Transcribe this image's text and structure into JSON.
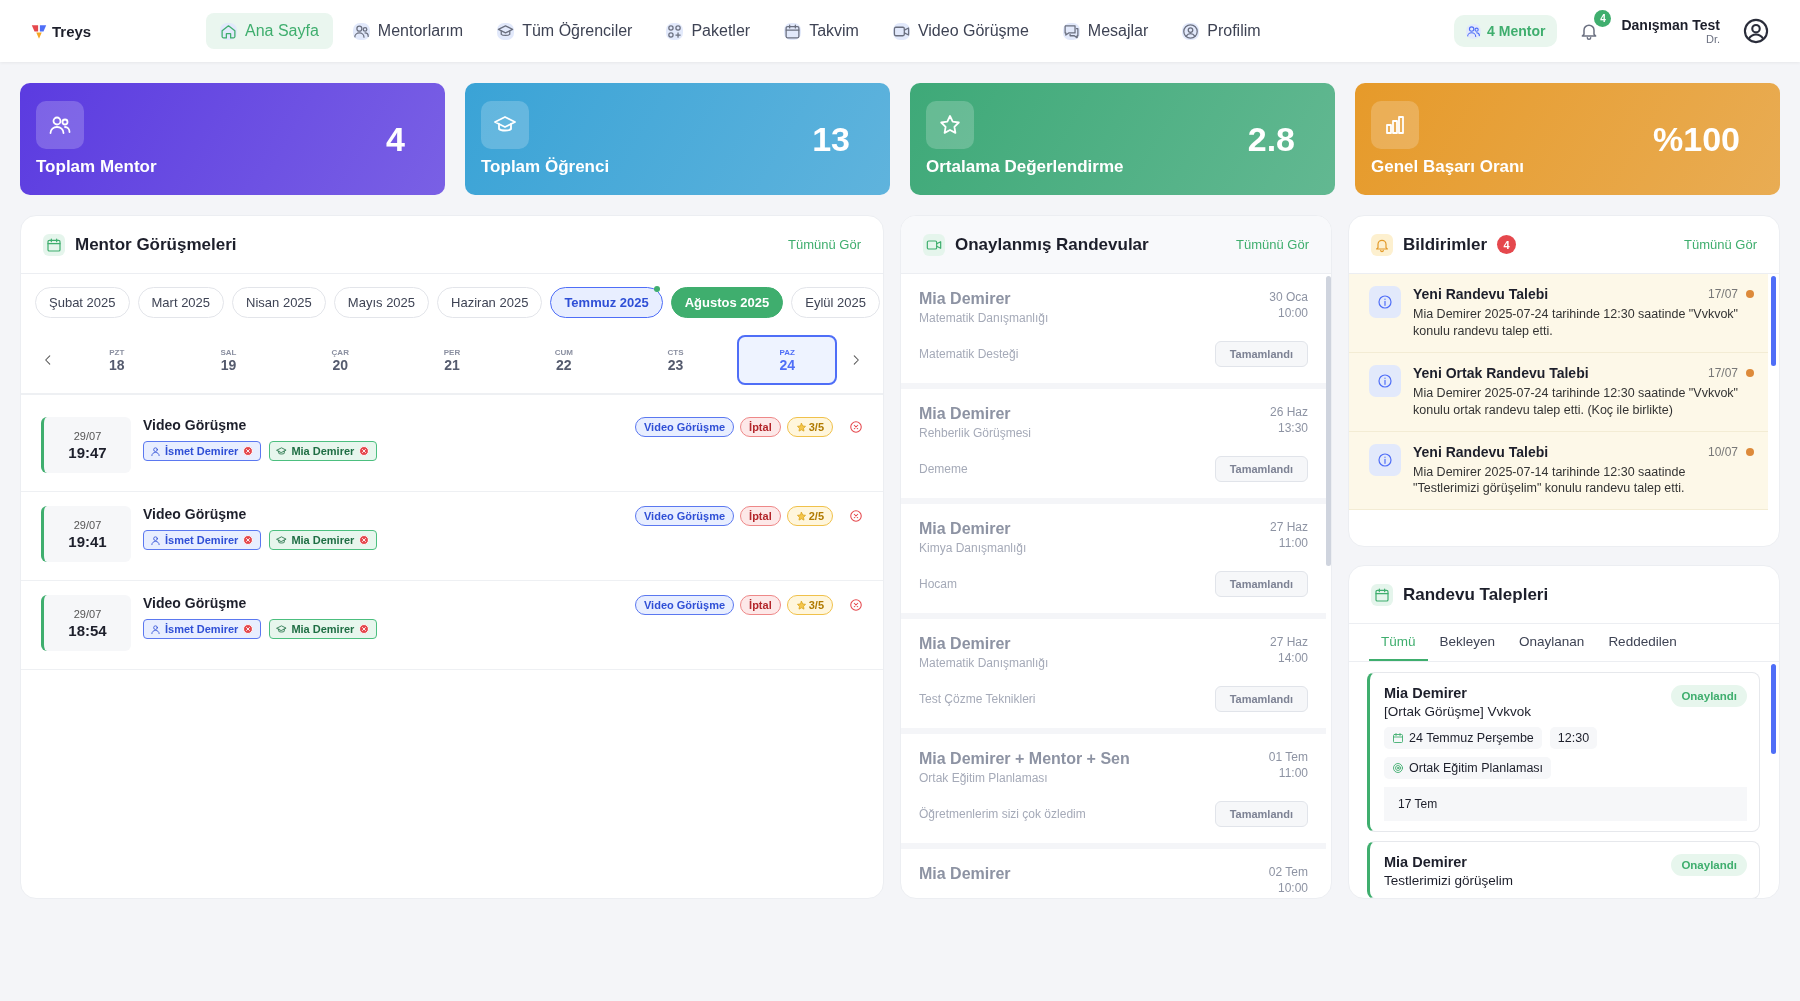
{
  "header": {
    "logo": "Treys",
    "nav": [
      {
        "label": "Ana Sayfa",
        "selected": true
      },
      {
        "label": "Mentorlarım",
        "selected": false
      },
      {
        "label": "Tüm Öğrenciler",
        "selected": false
      },
      {
        "label": "Paketler",
        "selected": false
      },
      {
        "label": "Takvim",
        "selected": false
      },
      {
        "label": "Video Görüşme",
        "selected": false
      },
      {
        "label": "Mesajlar",
        "selected": false
      },
      {
        "label": "Profilim",
        "selected": false
      }
    ],
    "mentor_badge": "4 Mentor",
    "notification_count": "4",
    "user_name": "Danışman Test",
    "user_title": "Dr."
  },
  "stats": [
    {
      "label": "Toplam Mentor",
      "value": "4",
      "color": "#5b3be0"
    },
    {
      "label": "Toplam Öğrenci",
      "value": "13",
      "color": "#3aa3d6"
    },
    {
      "label": "Ortalama Değerlendirme",
      "value": "2.8",
      "color": "#3ea978"
    },
    {
      "label": "Genel Başarı Oranı",
      "value": "%100",
      "color": "#e69a2a"
    }
  ],
  "mentor_meetings": {
    "title": "Mentor Görüşmeleri",
    "link": "Tümünü Gör",
    "months": [
      {
        "label": "Şubat 2025",
        "selected": false,
        "current": false
      },
      {
        "label": "Mart 2025",
        "selected": false,
        "current": false
      },
      {
        "label": "Nisan 2025",
        "selected": false,
        "current": false
      },
      {
        "label": "Mayıs 2025",
        "selected": false,
        "current": false
      },
      {
        "label": "Haziran 2025",
        "selected": false,
        "current": false
      },
      {
        "label": "Temmuz 2025",
        "selected": false,
        "current": true
      },
      {
        "label": "Ağustos 2025",
        "selected": true,
        "current": false
      },
      {
        "label": "Eylül 2025",
        "selected": false,
        "current": false
      }
    ],
    "days": [
      {
        "weekday": "PZT",
        "day": "18",
        "selected": false
      },
      {
        "weekday": "SAL",
        "day": "19",
        "selected": false
      },
      {
        "weekday": "ÇAR",
        "day": "20",
        "selected": false
      },
      {
        "weekday": "PER",
        "day": "21",
        "selected": false
      },
      {
        "weekday": "CUM",
        "day": "22",
        "selected": false
      },
      {
        "weekday": "CTS",
        "day": "23",
        "selected": false
      },
      {
        "weekday": "PAZ",
        "day": "24",
        "selected": true
      }
    ],
    "items": [
      {
        "date": "29/07",
        "time": "19:47",
        "title": "Video Görüşme",
        "mentor": "İsmet Demirer",
        "student": "Mia Demirer",
        "type": "Video Görüşme",
        "status": "İptal",
        "rating": "3/5"
      },
      {
        "date": "29/07",
        "time": "19:41",
        "title": "Video Görüşme",
        "mentor": "İsmet Demirer",
        "student": "Mia Demirer",
        "type": "Video Görüşme",
        "status": "İptal",
        "rating": "2/5"
      },
      {
        "date": "29/07",
        "time": "18:54",
        "title": "Video Görüşme",
        "mentor": "İsmet Demirer",
        "student": "Mia Demirer",
        "type": "Video Görüşme",
        "status": "İptal",
        "rating": "3/5"
      }
    ]
  },
  "approved": {
    "title": "Onaylanmış Randevular",
    "link": "Tümünü Gör",
    "items": [
      {
        "name": "Mia Demirer",
        "service": "Matematik Danışmanlığı",
        "date": "30 Oca",
        "time": "10:00",
        "note": "Matematik Desteği",
        "status": "Tamamlandı"
      },
      {
        "name": "Mia Demirer",
        "service": "Rehberlik Görüşmesi",
        "date": "26 Haz",
        "time": "13:30",
        "note": "Dememe",
        "status": "Tamamlandı"
      },
      {
        "name": "Mia Demirer",
        "service": "Kimya Danışmanlığı",
        "date": "27 Haz",
        "time": "11:00",
        "note": "Hocam",
        "status": "Tamamlandı"
      },
      {
        "name": "Mia Demirer",
        "service": "Matematik Danışmanlığı",
        "date": "27 Haz",
        "time": "14:00",
        "note": "Test Çözme Teknikleri",
        "status": "Tamamlandı"
      },
      {
        "name": "Mia Demirer + Mentor + Sen",
        "service": "Ortak Eğitim Planlaması",
        "date": "01 Tem",
        "time": "11:00",
        "note": "Öğretmenlerim sizi çok özledim",
        "status": "Tamamlandı"
      },
      {
        "name": "Mia Demirer",
        "date": "02 Tem",
        "time": "10:00"
      }
    ]
  },
  "notifications": {
    "title": "Bildirimler",
    "count": "4",
    "link": "Tümünü Gör",
    "items": [
      {
        "title": "Yeni Randevu Talebi",
        "date": "17/07",
        "body": "Mia Demirer 2025-07-24 tarihinde 12:30 saatinde \"Vvkvok\" konulu randevu talep etti.",
        "unread": true
      },
      {
        "title": "Yeni Ortak Randevu Talebi",
        "date": "17/07",
        "body": "Mia Demirer 2025-07-24 tarihinde 12:30 saatinde \"Vvkvok\" konulu ortak randevu talep etti. (Koç ile birlikte)",
        "unread": true
      },
      {
        "title": "Yeni Randevu Talebi",
        "date": "10/07",
        "body": "Mia Demirer 2025-07-14 tarihinde 12:30 saatinde \"Testlerimizi görüşelim\" konulu randevu talep etti.",
        "unread": true
      }
    ]
  },
  "requests": {
    "title": "Randevu Talepleri",
    "tabs": [
      {
        "label": "Tümü",
        "selected": true
      },
      {
        "label": "Bekleyen",
        "selected": false
      },
      {
        "label": "Onaylanan",
        "selected": false
      },
      {
        "label": "Reddedilen",
        "selected": false
      }
    ],
    "items": [
      {
        "name": "Mia Demirer",
        "subject": "[Ortak Görüşme] Vvkvok",
        "status": "Onaylandı",
        "date": "24 Temmuz Perşembe",
        "time": "12:30",
        "plan": "Ortak Eğitim Planlaması",
        "note": "17 Tem"
      },
      {
        "name": "Mia Demirer",
        "subject": "Testlerimizi görüşelim",
        "status": "Onaylandı"
      }
    ]
  }
}
